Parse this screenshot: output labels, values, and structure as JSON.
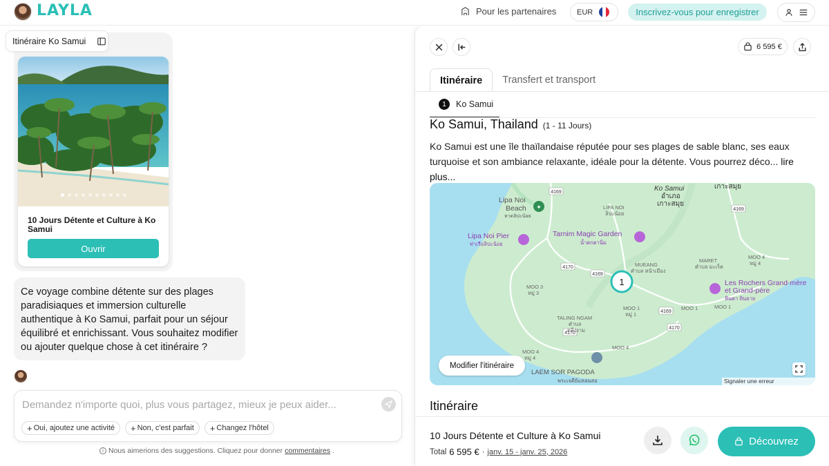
{
  "header": {
    "logo": "LAYLA",
    "partners_label": "Pour les partenaires",
    "currency": "EUR",
    "signup_label": "Inscrivez-vous pour enregistrer"
  },
  "chat": {
    "trip_tag": "Itinéraire Ko Samui",
    "card": {
      "title": "10 Jours Détente et Culture à Ko Samui",
      "open_label": "Ouvrir",
      "photo_count": 10,
      "active_photo": 1
    },
    "message": "Ce voyage combine détente sur des plages paradisiaques et immersion culturelle authentique à Ko Samui, parfait pour un séjour équilibré et enrichissant. Vous souhaitez modifier ou ajouter quelque chose à cet itinéraire ?",
    "composer": {
      "placeholder": "Demandez n'importe quoi, plus vous partagez, mieux je peux aider...",
      "value": ""
    },
    "chips": [
      "Oui, ajoutez une activité",
      "Non, c'est parfait",
      "Changez l'hôtel"
    ],
    "footnote_text": "Nous aimerions des suggestions. Cliquez pour donner",
    "footnote_link": "commentaires",
    "footnote_end": "."
  },
  "panel": {
    "price": "6 595 €",
    "tabs": [
      {
        "label": "Itinéraire",
        "active": true
      },
      {
        "label": "Transfert et transport",
        "active": false
      }
    ],
    "stop": {
      "number": "1",
      "label": "Ko Samui"
    },
    "destination": {
      "title": "Ko Samui, Thailand",
      "range": "(1 - 11 Jours)"
    },
    "description": "Ko Samui est une île thaïlandaise réputée pour ses plages de sable blanc, ses eaux turquoise et son ambiance relaxante, idéale pour la détente. Vous pourrez déco...",
    "read_more": "lire plus...",
    "map": {
      "edit_label": "Modifier l'itinéraire",
      "report_label": "Signaler une erreur cartographique",
      "marker": "1",
      "labels": {
        "ko_samui": "Ko Samui",
        "ko_samui_th": "อำเภอ",
        "ko_samui_th2": "เกาะสมุย",
        "ko_samui_th_top": "เกาะสมุย",
        "lipa_noi_beach": "Lipa Noi",
        "lipa_noi_beach2": "Beach",
        "lipa_noi_beach_th": "หาดลิปะน้อย",
        "lipa_noi": "LIPA NOI",
        "lipa_noi_th": "ลิปะน้อย",
        "lipa_noi_pier": "Lipa Noi Pier",
        "lipa_noi_pier_th": "ท่าเรือลิปะน้อย",
        "tarnim": "Tarnim Magic Garden",
        "tarnim_th": "น้ำตกตานิ่ม",
        "mueang": "MUEANG",
        "mueang_th": "ตำบล หน้าเมือง",
        "maret": "MARET",
        "maret_th": "ตำบล มะเร็ต",
        "moo4_ne": "MOO 4",
        "moo4_ne_th": "หมู่ 4",
        "moo3": "MOO 3",
        "moo3_th": "หมู่ 3",
        "moo1_a": "MOO 1",
        "moo1_a_th": "หมู่ 1",
        "moo1_b": "MOO 1",
        "moo1_c": "MOO 1",
        "taling": "TALING NGAM",
        "taling_th": "ตำบล",
        "taling_th2": "ตลิ่งงาม",
        "rochers": "Les Rochers Grand-mère",
        "rochers2": "et Grand-père",
        "rochers_th": "หินตา หินยาย",
        "moo4_sw": "MOO 4",
        "moo4_sw_th": "หมู่ 4",
        "moo4_s": "MOO 4",
        "laem": "LAEM SOR PAGODA",
        "laem_th": "พระเจดีย์แหลมสอ",
        "r4169_a": "4169",
        "r4169_b": "4169",
        "r4169_c": "4169",
        "r4169_d": "4169",
        "r4170_a": "4170",
        "r4170_b": "4170",
        "r4170_c": "4170"
      }
    },
    "itinerary_heading": "Itinéraire",
    "bottom": {
      "title": "10 Jours Détente et Culture à Ko Samui",
      "total_label": "Total",
      "total": "6 595 €",
      "separator": "·",
      "dates": "janv. 15 - janv. 25, 2026",
      "discover_label": "Découvrez"
    }
  },
  "colors": {
    "brand": "#2bbfb6",
    "brand_light": "#d4f2ef",
    "whatsapp_bg": "#dff5ef",
    "map_water": "#a8dff0",
    "map_land": "#cdeccf"
  },
  "icons": {
    "partners": "building-icon",
    "close": "close-icon",
    "collapse": "collapse-left-icon",
    "bag": "bag-icon",
    "share": "share-icon",
    "sidebar": "sidebar-icon",
    "send": "send-icon",
    "download": "download-icon",
    "whatsapp": "whatsapp-icon",
    "fullscreen": "fullscreen-icon"
  }
}
